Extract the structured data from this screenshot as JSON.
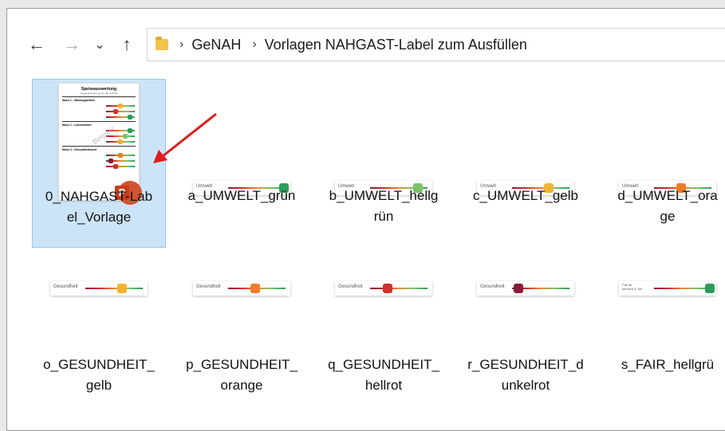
{
  "nav": {
    "back": "←",
    "forward": "→",
    "recent": "⌄",
    "up": "↑"
  },
  "breadcrumb": {
    "sep1": "›",
    "part1": "GeNAH",
    "sep2": "›",
    "part2": "Vorlagen NAHGAST-Label zum Ausfüllen"
  },
  "files_top": [
    {
      "name": "0_NAHGAST-Lab\nel_Vorlage"
    },
    {
      "name": "a_UMWELT_grün",
      "label_text": "Umwelt",
      "color": "#2c9c5a"
    },
    {
      "name": "b_UMWELT_hellg\nrün",
      "label_text": "Umwelt",
      "color": "#7cc36b"
    },
    {
      "name": "c_UMWELT_gelb",
      "label_text": "Umwelt",
      "color": "#f2b233"
    },
    {
      "name": "d_UMWELT_ora\nge",
      "label_text": "Umwelt",
      "color": "#ee7a2a"
    }
  ],
  "files_bottom": [
    {
      "name": "o_GESUNDHEIT_\ngelb",
      "label_text": "Gesundheit",
      "color": "#f2b233"
    },
    {
      "name": "p_GESUNDHEIT_\norange",
      "label_text": "Gesundheit",
      "color": "#ee7a2a"
    },
    {
      "name": "q_GESUNDHEIT_\nhellrot",
      "label_text": "Gesundheit",
      "color": "#d0302e"
    },
    {
      "name": "r_GESUNDHEIT_d\nunkelrot",
      "label_text": "Gesundheit",
      "color": "#8b1a3a"
    },
    {
      "name": "s_FAIR_hellgrü",
      "label_text": "Fair für\nMensch & Tier",
      "color": "#7cc36b"
    }
  ],
  "doc": {
    "title": "Speiseauswertung",
    "subtitle": "Speiseauswertung aus der GeNAH",
    "s1": "Muss 1 - Nahrungsmittel",
    "s2": "Muss 2 - Lebensmittel",
    "s3": "Muss 3 - Gesundheitswert",
    "wm": "Beispiel",
    "ppt": "P"
  }
}
